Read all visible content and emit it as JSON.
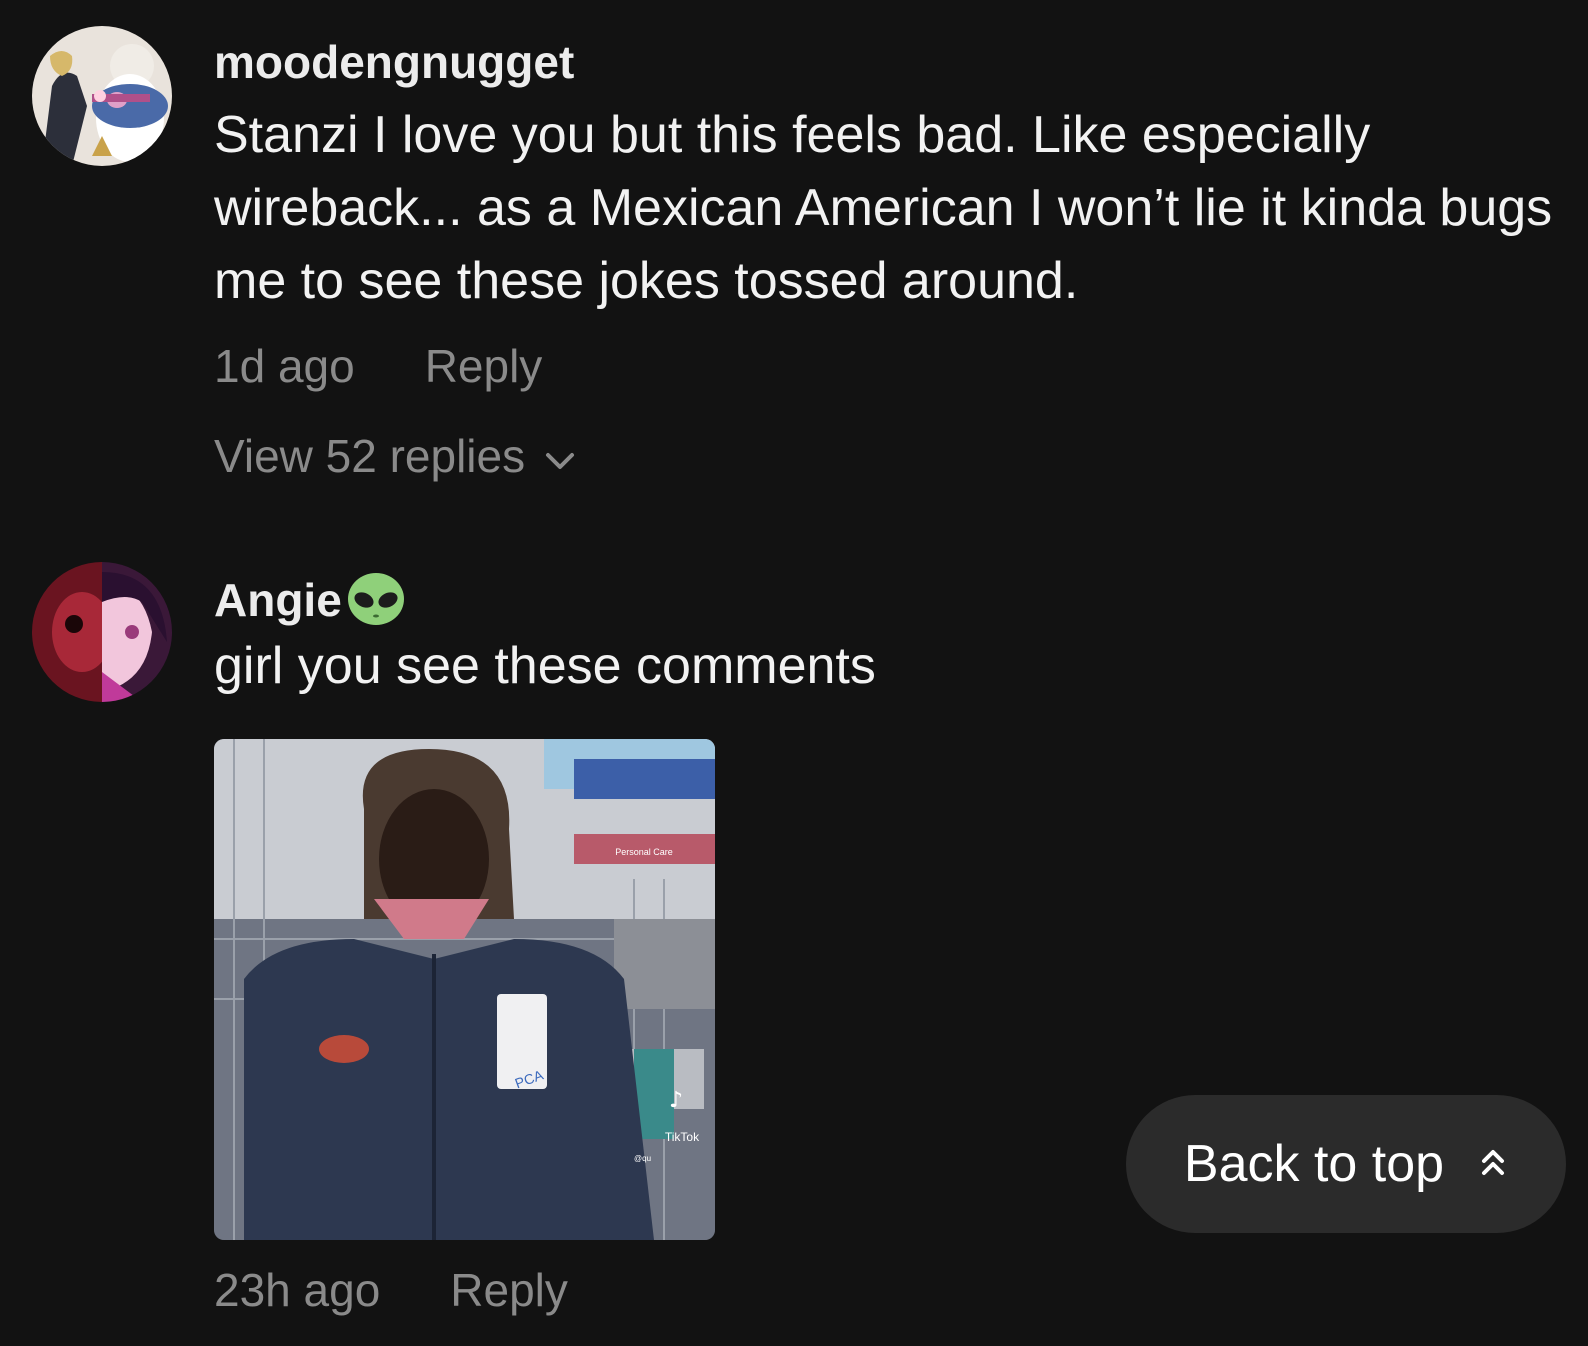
{
  "comments": [
    {
      "username": "moodengnugget",
      "text": "Stanzi I love you but this feels bad. Like especially wireback... as a Mexican American I won’t lie it kinda bugs me to see these jokes tossed around.",
      "timestamp": "1d ago",
      "reply_label": "Reply",
      "view_replies_label": "View 52 replies"
    },
    {
      "username": "Angie",
      "username_emoji": "alien-emoji",
      "text": "girl you see these comments",
      "timestamp": "23h ago",
      "reply_label": "Reply",
      "media": {
        "sign_text": "Personal Care",
        "badge_text": "PCA",
        "watermark": "TikTok",
        "watermark_handle": "@qu"
      }
    }
  ],
  "back_to_top": {
    "label": "Back to top",
    "icon": "double-chevron-up-icon"
  },
  "colors": {
    "background": "#121212",
    "text_primary": "#ececec",
    "text_secondary": "#8a8a8a",
    "button_bg": "#2b2b2b"
  }
}
